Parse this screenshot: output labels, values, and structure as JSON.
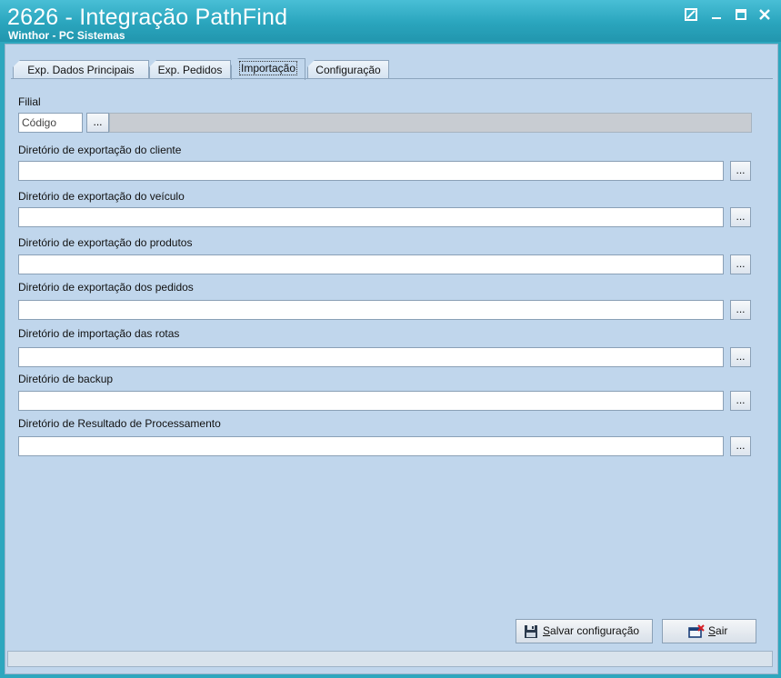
{
  "window": {
    "title": "2626 - Integração PathFind",
    "subtitle": "Winthor - PC Sistemas"
  },
  "tabs": [
    {
      "label": "Exp. Dados Principais"
    },
    {
      "label": "Exp. Pedidos"
    },
    {
      "label": "Importação"
    },
    {
      "label": "Configuração"
    }
  ],
  "filial": {
    "label": "Filial",
    "code_value": "Código",
    "button_label": "..."
  },
  "fields": [
    {
      "label": "Diretório de exportação do cliente",
      "value": ""
    },
    {
      "label": "Diretório de exportação do veículo",
      "value": ""
    },
    {
      "label": "Diretório de exportação do produtos",
      "value": ""
    },
    {
      "label": "Diretório de exportação dos pedidos",
      "value": ""
    },
    {
      "label": "Diretório de importação das rotas",
      "value": ""
    },
    {
      "label": "Diretório de backup",
      "value": ""
    },
    {
      "label": "Diretório de Resultado de Processamento",
      "value": ""
    }
  ],
  "browse_label": "...",
  "buttons": {
    "save_first": "S",
    "save_rest": "alvar configuração",
    "exit_first": "S",
    "exit_rest": "air"
  },
  "colors": {
    "highlight": "#e0141c",
    "titlebar": "#2aa5bd",
    "panel": "#c0d6ec"
  }
}
